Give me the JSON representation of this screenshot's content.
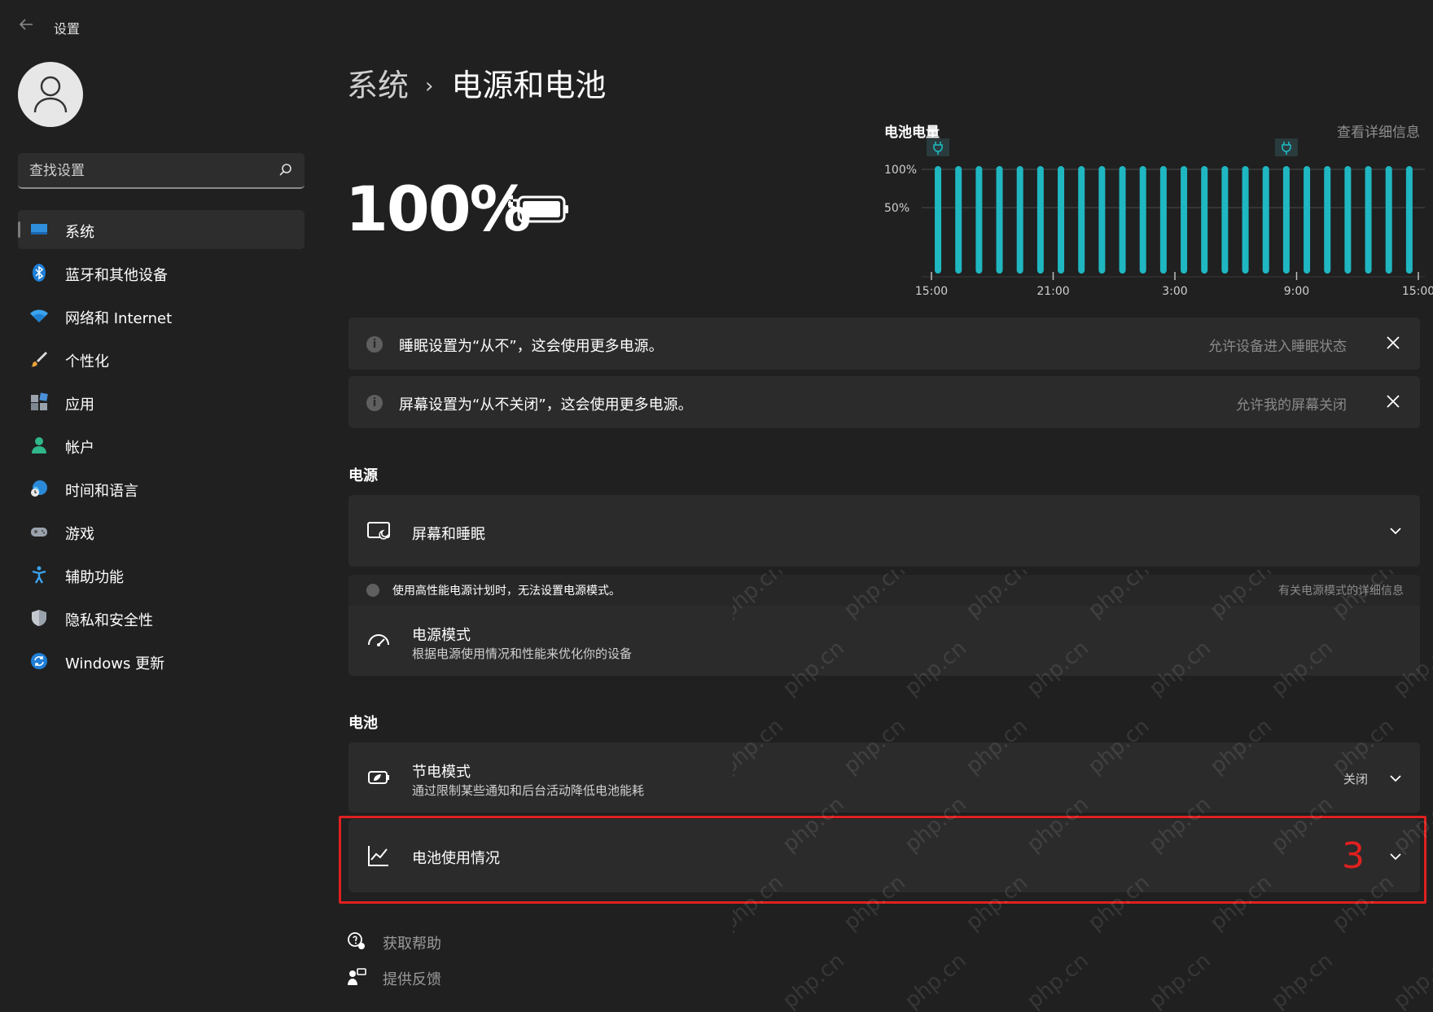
{
  "app": {
    "title": "设置"
  },
  "profile": {
    "name": ""
  },
  "search": {
    "placeholder": "查找设置"
  },
  "sidebar": {
    "items": [
      {
        "label": "系统",
        "icon": "system-icon",
        "active": true
      },
      {
        "label": "蓝牙和其他设备",
        "icon": "bluetooth-icon"
      },
      {
        "label": "网络和 Internet",
        "icon": "wifi-icon"
      },
      {
        "label": "个性化",
        "icon": "brush-icon"
      },
      {
        "label": "应用",
        "icon": "apps-icon"
      },
      {
        "label": "帐户",
        "icon": "account-icon"
      },
      {
        "label": "时间和语言",
        "icon": "globe-clock-icon"
      },
      {
        "label": "游戏",
        "icon": "gamepad-icon"
      },
      {
        "label": "辅助功能",
        "icon": "accessibility-icon"
      },
      {
        "label": "隐私和安全性",
        "icon": "shield-icon"
      },
      {
        "label": "Windows 更新",
        "icon": "update-icon"
      }
    ]
  },
  "breadcrumb": {
    "parent": "系统",
    "separator": "›",
    "current": "电源和电池"
  },
  "battery": {
    "percent_text": "100%",
    "level": 1.0,
    "charging": true
  },
  "chart": {
    "title": "电池电量",
    "link": "查看详细信息"
  },
  "chart_data": {
    "type": "bar",
    "title": "电池电量",
    "ylabel": "",
    "xlabel": "",
    "y_ticks": [
      "100%",
      "50%"
    ],
    "x_ticks": [
      "15:00",
      "21:00",
      "3:00",
      "9:00",
      "15:00"
    ],
    "ylim": [
      0,
      100
    ],
    "bar_count": 24,
    "values": [
      100,
      100,
      100,
      100,
      100,
      100,
      100,
      100,
      100,
      100,
      100,
      100,
      100,
      100,
      100,
      100,
      100,
      100,
      100,
      100,
      100,
      100,
      100,
      100
    ],
    "plug_markers_at_bar": [
      0,
      17
    ],
    "bar_color": "#1fb7c1",
    "grid": true
  },
  "notices": [
    {
      "text": "睡眠设置为“从不”，这会使用更多电源。",
      "action": "允许设备进入睡眠状态"
    },
    {
      "text": "屏幕设置为“从不关闭”，这会使用更多电源。",
      "action": "允许我的屏幕关闭"
    }
  ],
  "sections": {
    "power": {
      "title": "电源",
      "screen_sleep": {
        "title": "屏幕和睡眠"
      },
      "sub_notice": {
        "text": "使用高性能电源计划时，无法设置电源模式。",
        "link": "有关电源模式的详细信息"
      },
      "power_mode": {
        "title": "电源模式",
        "subtitle": "根据电源使用情况和性能来优化你的设备"
      }
    },
    "battery": {
      "title": "电池",
      "saver": {
        "title": "节电模式",
        "subtitle": "通过限制某些通知和后台活动降低电池能耗",
        "value": "关闭"
      },
      "usage": {
        "title": "电池使用情况"
      }
    }
  },
  "annotation": {
    "step_number": "3",
    "color": "#e02020"
  },
  "footer": {
    "help": "获取帮助",
    "feedback": "提供反馈"
  },
  "watermark": {
    "text": "php.cn"
  }
}
